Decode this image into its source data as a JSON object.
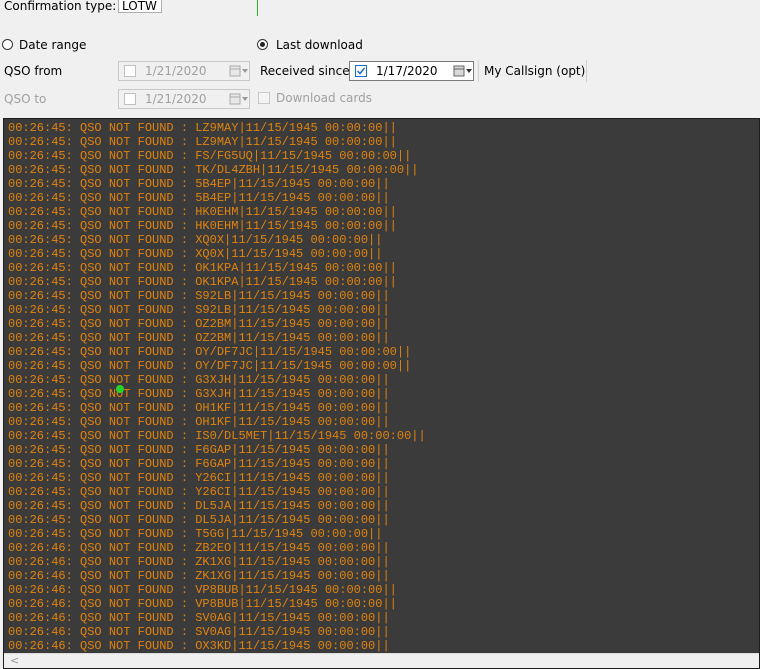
{
  "top": {
    "confirmation_label": "Confirmation type:",
    "confirmation_value": "LOTW"
  },
  "range": {
    "date_range_label": "Date range",
    "last_download_label": "Last download",
    "selected": "last_download"
  },
  "qso_from": {
    "label": "QSO from",
    "value": "1/21/2020",
    "checked": false
  },
  "qso_to": {
    "label": "QSO to",
    "value": "1/21/2020",
    "checked": false
  },
  "received_since": {
    "label": "Received since",
    "value": "1/17/2020",
    "checked": true
  },
  "my_callsign_label": "My Callsign (opt)",
  "download_cards_label": "Download cards",
  "colors": {
    "log_bg": "#3b3b3b",
    "log_text": "#e0830e"
  },
  "log": {
    "lines": [
      "00:26:45: QSO NOT FOUND : LZ9MAY|11/15/1945 00:00:00||",
      "00:26:45: QSO NOT FOUND : LZ9MAY|11/15/1945 00:00:00||",
      "00:26:45: QSO NOT FOUND : FS/FG5UQ|11/15/1945 00:00:00||",
      "00:26:45: QSO NOT FOUND : TK/DL4ZBH|11/15/1945 00:00:00||",
      "00:26:45: QSO NOT FOUND : 5B4EP|11/15/1945 00:00:00||",
      "00:26:45: QSO NOT FOUND : 5B4EP|11/15/1945 00:00:00||",
      "00:26:45: QSO NOT FOUND : HK0EHM|11/15/1945 00:00:00||",
      "00:26:45: QSO NOT FOUND : HK0EHM|11/15/1945 00:00:00||",
      "00:26:45: QSO NOT FOUND : XQ0X|11/15/1945 00:00:00||",
      "00:26:45: QSO NOT FOUND : XQ0X|11/15/1945 00:00:00||",
      "00:26:45: QSO NOT FOUND : OK1KPA|11/15/1945 00:00:00||",
      "00:26:45: QSO NOT FOUND : OK1KPA|11/15/1945 00:00:00||",
      "00:26:45: QSO NOT FOUND : S92LB|11/15/1945 00:00:00||",
      "00:26:45: QSO NOT FOUND : S92LB|11/15/1945 00:00:00||",
      "00:26:45: QSO NOT FOUND : OZ2BM|11/15/1945 00:00:00||",
      "00:26:45: QSO NOT FOUND : OZ2BM|11/15/1945 00:00:00||",
      "00:26:45: QSO NOT FOUND : OY/DF7JC|11/15/1945 00:00:00||",
      "00:26:45: QSO NOT FOUND : OY/DF7JC|11/15/1945 00:00:00||",
      "00:26:45: QSO NOT FOUND : G3XJH|11/15/1945 00:00:00||",
      "00:26:45: QSO NOT FOUND : G3XJH|11/15/1945 00:00:00||",
      "00:26:45: QSO NOT FOUND : OH1KF|11/15/1945 00:00:00||",
      "00:26:45: QSO NOT FOUND : OH1KF|11/15/1945 00:00:00||",
      "00:26:45: QSO NOT FOUND : IS0/DL5MET|11/15/1945 00:00:00||",
      "00:26:45: QSO NOT FOUND : F6GAP|11/15/1945 00:00:00||",
      "00:26:45: QSO NOT FOUND : F6GAP|11/15/1945 00:00:00||",
      "00:26:45: QSO NOT FOUND : Y26CI|11/15/1945 00:00:00||",
      "00:26:45: QSO NOT FOUND : Y26CI|11/15/1945 00:00:00||",
      "00:26:45: QSO NOT FOUND : DL5JA|11/15/1945 00:00:00||",
      "00:26:45: QSO NOT FOUND : DL5JA|11/15/1945 00:00:00||",
      "00:26:45: QSO NOT FOUND : T5GG|11/15/1945 00:00:00||",
      "00:26:46: QSO NOT FOUND : ZB2EO|11/15/1945 00:00:00||",
      "00:26:46: QSO NOT FOUND : ZK1XG|11/15/1945 00:00:00||",
      "00:26:46: QSO NOT FOUND : ZK1XG|11/15/1945 00:00:00||",
      "00:26:46: QSO NOT FOUND : VP8BUB|11/15/1945 00:00:00||",
      "00:26:46: QSO NOT FOUND : VP8BUB|11/15/1945 00:00:00||",
      "00:26:46: QSO NOT FOUND : SV0AG|11/15/1945 00:00:00||",
      "00:26:46: QSO NOT FOUND : SV0AG|11/15/1945 00:00:00||",
      "00:26:46: QSO NOT FOUND : OX3KD|11/15/1945 00:00:00||"
    ]
  }
}
